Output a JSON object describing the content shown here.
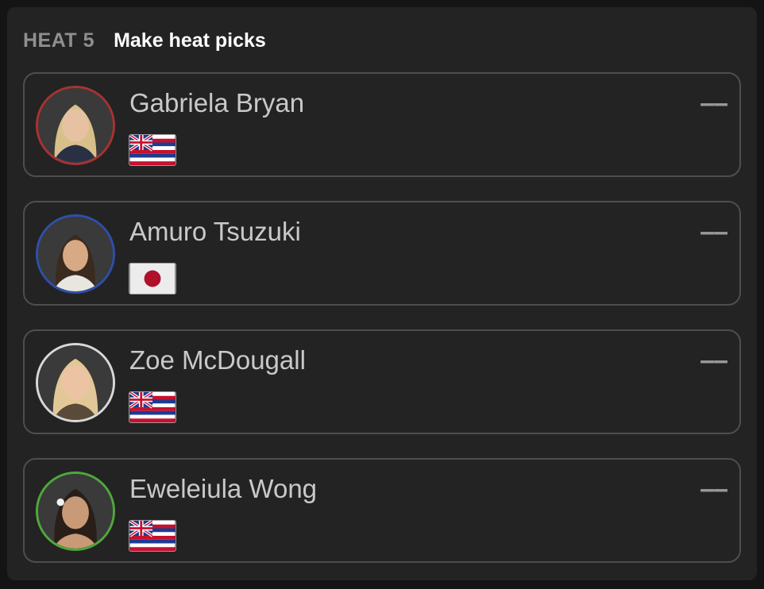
{
  "heat": {
    "label": "HEAT 5",
    "title": "Make heat picks"
  },
  "surfers": [
    {
      "name": "Gabriela Bryan",
      "flag": "hawaii-flag-icon",
      "ring_color": "#a83232",
      "score": "––"
    },
    {
      "name": "Amuro Tsuzuki",
      "flag": "japan-flag-icon",
      "ring_color": "#2f4fa8",
      "score": "––"
    },
    {
      "name": "Zoe McDougall",
      "flag": "hawaii-flag-icon",
      "ring_color": "#d8d8d8",
      "score": "––"
    },
    {
      "name": "Eweleiula Wong",
      "flag": "hawaii-flag-icon",
      "ring_color": "#4fa83c",
      "score": "––"
    }
  ]
}
